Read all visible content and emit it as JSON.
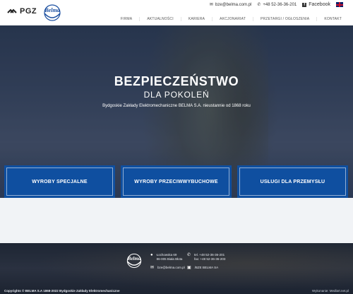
{
  "header": {
    "pgz_logo_text": "PGZ",
    "belma_logo_text": "Belma",
    "email": "bze@belma.com.pl",
    "phone": "+48 52-36-36-201",
    "facebook_label": "Facebook",
    "language_flag": "english-flag-icon"
  },
  "nav": {
    "items": [
      "FIRMA",
      "AKTUALNOŚCI",
      "KARIERA",
      "AKCJONARIAT",
      "PRZETARGI / OGŁOSZENIA",
      "KONTAKT"
    ]
  },
  "hero": {
    "title_line1": "BEZPIECZEŃSTWO",
    "title_line2": "DLA POKOLEŃ",
    "subtitle": "Bydgoskie Zakłady Elektromechaniczne BELMA S.A. nieustannie od 1868 roku"
  },
  "cards": [
    {
      "label": "WYROBY SPECJALNE"
    },
    {
      "label": "WYROBY PRZECIWWYBUCHOWE"
    },
    {
      "label": "USŁUGI DLA PRZEMYSŁU"
    }
  ],
  "footer": {
    "address_line1": "Łochowska 69",
    "address_line2": "86-005 Biała Błota",
    "tel": "tel. +48 52-36-36-201",
    "fax": "fax: +48 52-36-36-203",
    "email": "bze@belma.com.pl",
    "epuap": "/BZE BELMA SA",
    "copyright": "Copyrights © BELMA S.A 1868-2022 Bydgoskie Zakłady Elektromechaniczne",
    "credit": "Wykonanie: Medlart.net.pl"
  },
  "colors": {
    "card_blue": "#0f4fa0",
    "hero_dark": "#2e3a4c",
    "footer_dark": "#1e2634"
  }
}
